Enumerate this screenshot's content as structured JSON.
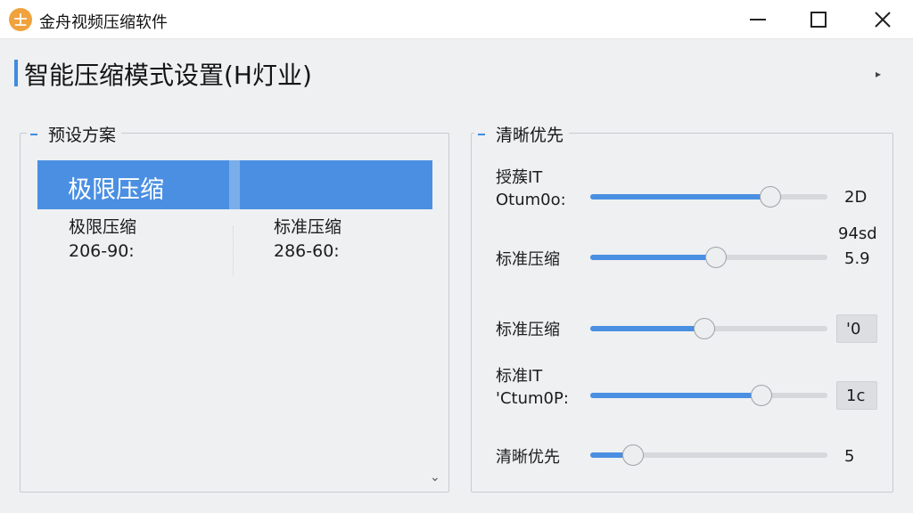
{
  "window": {
    "logo_glyph": "士",
    "title": "金舟视频压缩软件"
  },
  "header": {
    "title": "智能压缩模式设置(H灯业)",
    "caret": "▸"
  },
  "presets": {
    "legend": "预设方案",
    "selected": "极限压缩",
    "items": [
      {
        "name": "极限压缩",
        "value": "206-90:"
      },
      {
        "name": "标准压缩",
        "value": "286-60:"
      }
    ]
  },
  "sliders_panel": {
    "legend": "清晰优先",
    "sliders": [
      {
        "label_line1": "授蔟IT",
        "label_line2": "Otum0o:",
        "level": 0.76,
        "value": "2D",
        "boxed": false
      },
      {
        "label_line1": "标准压缩",
        "label_line2": "",
        "level": 0.53,
        "value_extra": "94sd",
        "value": "5.9",
        "boxed": false
      },
      {
        "label_line1": "标准压缩",
        "label_line2": "",
        "level": 0.48,
        "value": "'0",
        "boxed": true
      },
      {
        "label_line1": "标准IT",
        "label_line2": "'Ctum0P:",
        "level": 0.72,
        "value": "1c",
        "boxed": true
      },
      {
        "label_line1": "清晰优先",
        "label_line2": "",
        "level": 0.18,
        "value": "5",
        "boxed": false
      }
    ]
  },
  "colors": {
    "accent": "#4a8fe2",
    "logo": "#f0a23c"
  }
}
